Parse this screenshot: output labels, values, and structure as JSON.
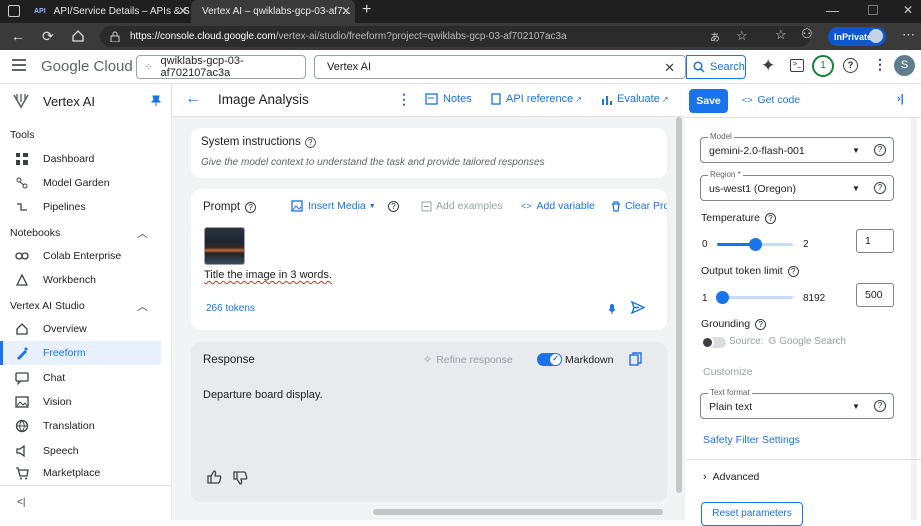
{
  "browser": {
    "tabs": [
      {
        "label": "API/Service Details – APIs & Servi",
        "favicon": "API"
      },
      {
        "label": "Vertex AI – qwiklabs-gcp-03-af7..."
      }
    ],
    "url_host": "https://console.cloud.google.com",
    "url_path": "/vertex-ai/studio/freeform?project=qwiklabs-gcp-03-af702107ac3a",
    "inprivate_label": "InPrivate"
  },
  "gcloud": {
    "logo": "Google Cloud",
    "project": "qwiklabs-gcp-03-af702107ac3a",
    "search_value": "Vertex AI",
    "search_button": "Search",
    "notifications_count": "1",
    "avatar_letter": "S"
  },
  "sidebar": {
    "product": "Vertex AI",
    "sections": {
      "tools": "Tools",
      "notebooks": "Notebooks",
      "studio": "Vertex AI Studio"
    },
    "items": {
      "dashboard": "Dashboard",
      "model_garden": "Model Garden",
      "pipelines": "Pipelines",
      "colab": "Colab Enterprise",
      "workbench": "Workbench",
      "overview": "Overview",
      "freeform": "Freeform",
      "chat": "Chat",
      "vision": "Vision",
      "translation": "Translation",
      "speech": "Speech",
      "marketplace": "Marketplace"
    },
    "collapse_glyph": "<|"
  },
  "center": {
    "title": "Image Analysis",
    "notes": "Notes",
    "api_reference": "API reference",
    "evaluate": "Evaluate",
    "system_instructions_title": "System instructions",
    "system_instructions_placeholder": "Give the model context to understand the task and provide tailored responses",
    "prompt_label": "Prompt",
    "insert_media": "Insert Media",
    "add_examples": "Add examples",
    "add_variable": "Add variable",
    "clear_prompt": "Clear Pror",
    "prompt_text": "Title the image in 3 words.",
    "tokens": "266 tokens",
    "response_label": "Response",
    "refine_response": "Refine response",
    "markdown": "Markdown",
    "response_text": "Departure board display."
  },
  "right": {
    "save": "Save",
    "get_code": "Get code",
    "model_label": "Model",
    "model_value": "gemini-2.0-flash-001",
    "region_label": "Region *",
    "region_value": "us-west1 (Oregon)",
    "temperature_label": "Temperature",
    "temperature_min": "0",
    "temperature_max": "2",
    "temperature_value": "1",
    "temperature_fraction": 0.5,
    "output_label": "Output token limit",
    "output_min": "1",
    "output_max": "8192",
    "output_value": "500",
    "grounding_label": "Grounding",
    "source_label": "Source:",
    "source_value": "Google Search",
    "customize_label": "Customize",
    "text_format_label": "Text format",
    "text_format_value": "Plain text",
    "safety_link": "Safety Filter Settings",
    "advanced_label": "Advanced",
    "reset_button": "Reset parameters"
  },
  "colors": {
    "accent": "#1a73e8",
    "browser_dark": "#1f1f1f",
    "freeform_selected": "#e8f0fe"
  }
}
